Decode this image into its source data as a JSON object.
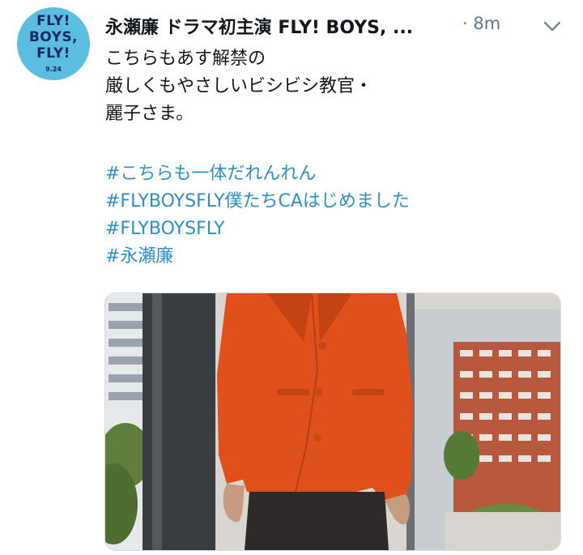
{
  "avatar": {
    "line1": "FLY!",
    "line2": "BOYS,",
    "line3": "FLY!",
    "date": "9.24"
  },
  "tweet": {
    "display_name": "永瀬廉 ドラマ初主演 FLY! BOYS, ...",
    "time": "· 8m",
    "lines": [
      "こちらもあす解禁の",
      "厳しくもやさしいビシビシ教官・",
      "麗子さま。"
    ],
    "hashtags": [
      "#こちらも一体だれんれん",
      "#FLYBOYSFLY僕たちCAはじめました",
      "#FLYBOYSFLY",
      "#永瀬廉"
    ]
  },
  "colors": {
    "link": "#2d8fc7",
    "meta": "#657786",
    "avatar_bg": "#5bbde0",
    "jacket": "#e0501c"
  },
  "icons": {
    "menu": "chevron-down-icon"
  }
}
